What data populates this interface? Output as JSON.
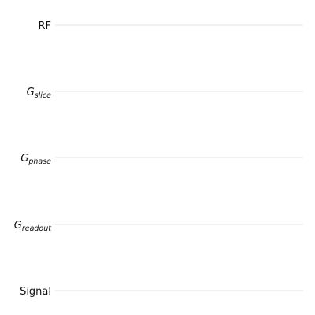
{
  "rows": [
    {
      "key": "rf",
      "label": "RF",
      "subscript": ""
    },
    {
      "key": "slice",
      "label": "G",
      "subscript": "slice"
    },
    {
      "key": "phase",
      "label": "G",
      "subscript": "phase"
    },
    {
      "key": "readout",
      "label": "G",
      "subscript": "readout"
    },
    {
      "key": "signal",
      "label": "Signal",
      "subscript": ""
    }
  ],
  "colors": {
    "line": "#e6e6e6",
    "text": "#111111",
    "background": "#ffffff"
  }
}
